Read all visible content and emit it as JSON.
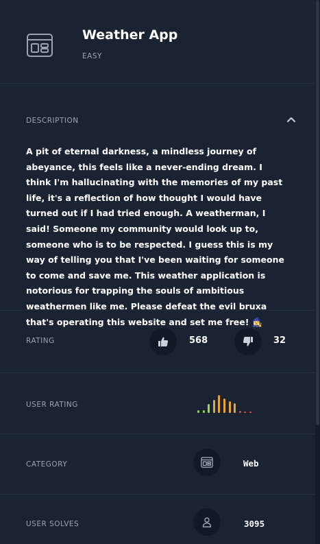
{
  "challenge": {
    "title": "Weather App",
    "difficulty": "EASY",
    "icon": "web-window-icon"
  },
  "description": {
    "label": "DESCRIPTION",
    "text": "A pit of eternal darkness, a mindless journey of abeyance, this feels like a never-ending dream. I think I'm hallucinating with the memories of my past life, it's a reflection of how thought I would have turned out if I had tried enough. A weatherman, I said! Someone my community would look up to, someone who is to be respected. I guess this is my way of telling you that I've been waiting for someone to come and save me. This weather application is notorious for trapping the souls of ambitious weathermen like me. Please defeat the evil bruxa that's operating this website and set me free! 🧙‍♀️"
  },
  "rating": {
    "label": "RATING",
    "likes": "568",
    "dislikes": "32"
  },
  "user_rating": {
    "label": "USER RATING",
    "bars": [
      {
        "level": 0.15,
        "color": "#8fd14f"
      },
      {
        "level": 0.15,
        "color": "#8fd14f"
      },
      {
        "level": 0.5,
        "color": "#a8d34a"
      },
      {
        "level": 0.75,
        "color": "#e8a33a"
      },
      {
        "level": 1.0,
        "color": "#e8a33a"
      },
      {
        "level": 0.8,
        "color": "#e8a33a"
      },
      {
        "level": 0.65,
        "color": "#e8a33a"
      },
      {
        "level": 0.55,
        "color": "#e8a33a"
      },
      {
        "level": 0.12,
        "color": "#e5484d"
      },
      {
        "level": 0.08,
        "color": "#e5484d"
      },
      {
        "level": 0.08,
        "color": "#e5484d"
      }
    ]
  },
  "category": {
    "label": "CATEGORY",
    "value": "Web"
  },
  "user_solves": {
    "label": "USER SOLVES",
    "value": "3095"
  },
  "colors": {
    "background": "#1a2332",
    "muted_text": "#9aa4b5",
    "circle_bg": "#111926"
  }
}
